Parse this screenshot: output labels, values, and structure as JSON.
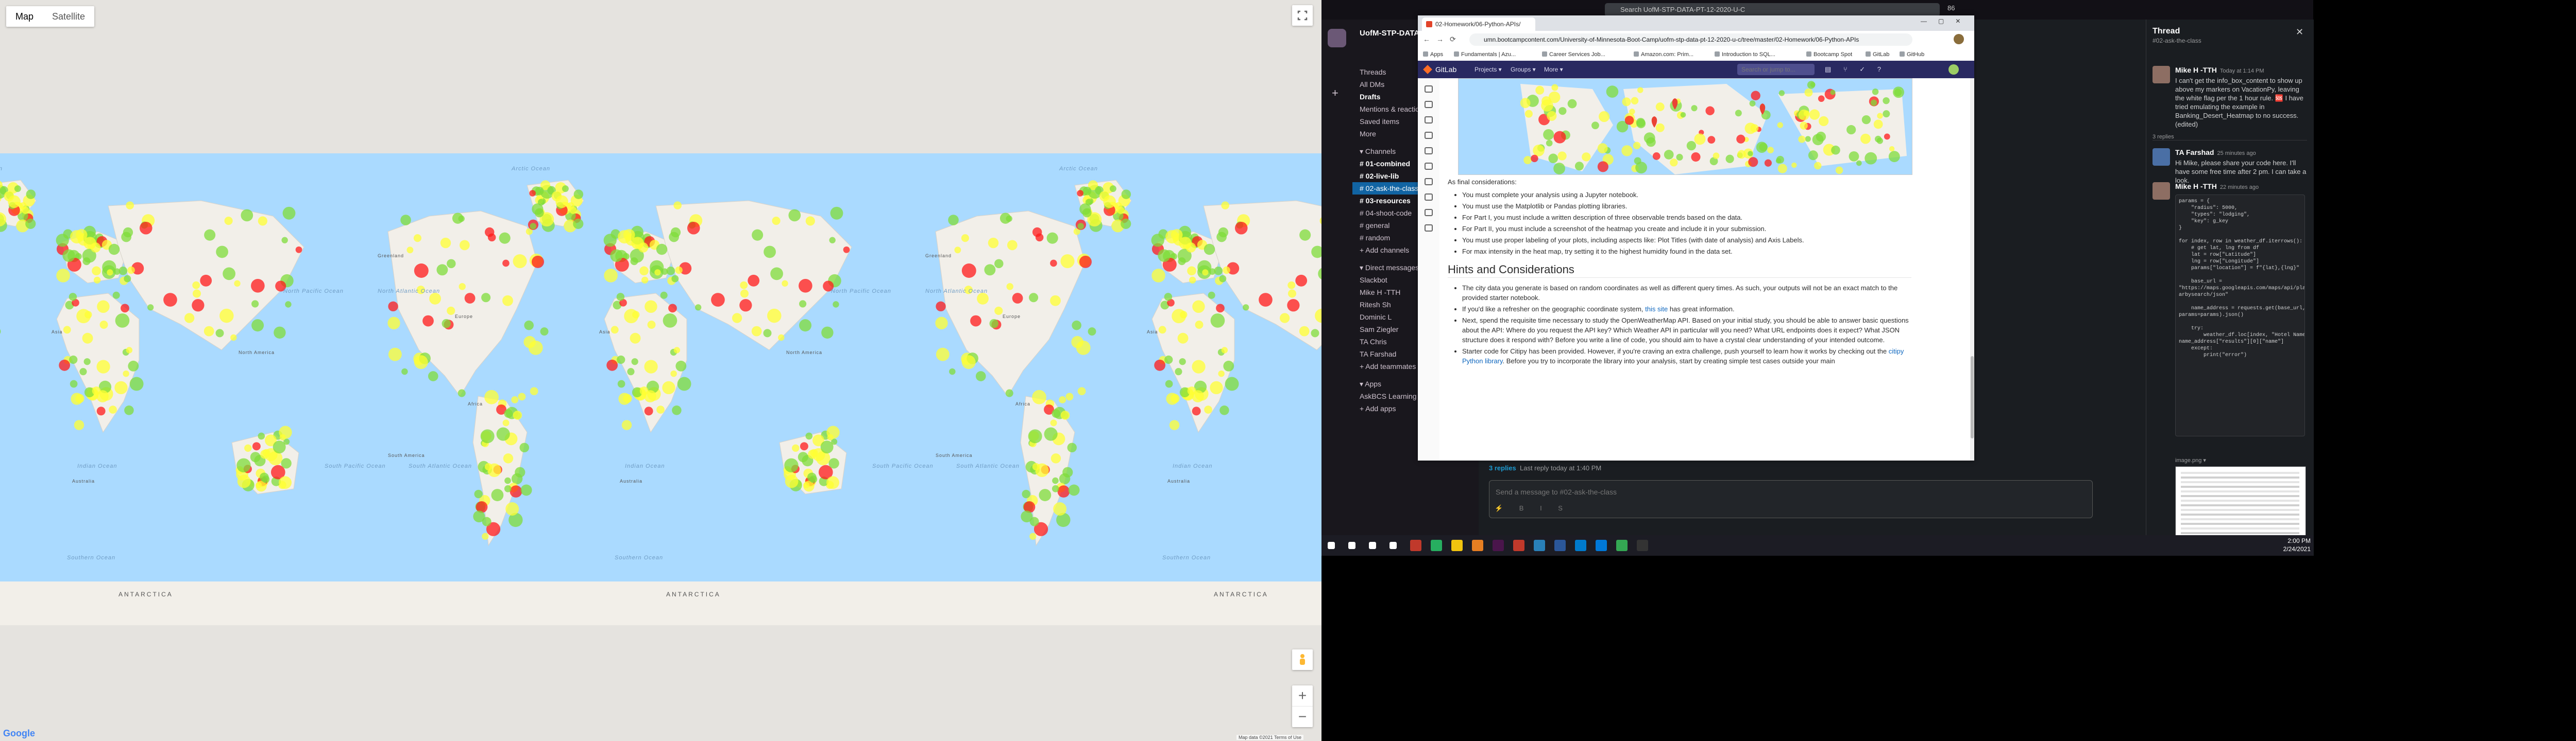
{
  "map": {
    "type_control": {
      "map_label": "Map",
      "satellite_label": "Satellite"
    },
    "google_logo": "Google",
    "attribution": "Map data ©2021   Terms of Use",
    "ocean_labels": {
      "arctic": "Arctic Ocean",
      "north_pacific": "North Pacific Ocean",
      "south_pacific": "South Pacific Ocean",
      "north_atlantic": "North Atlantic Ocean",
      "south_atlantic": "South Atlantic Ocean",
      "indian": "Indian Ocean",
      "southern": "Southern Ocean"
    },
    "continent_labels": {
      "north_america": "North America",
      "south_america": "South America",
      "africa": "Africa",
      "europe": "Europe",
      "asia": "Asia",
      "australia": "Australia",
      "greenland": "Greenland",
      "antarctica": "ANTARCTICA"
    },
    "zoom_in": "+",
    "zoom_out": "−",
    "heatmap_colors": {
      "low": "#7fdc3a",
      "mid": "#ffff33",
      "high": "#ff1a1a"
    }
  },
  "slack": {
    "search_placeholder": "Search UofM-STP-DATA-PT-12-2020-U-C",
    "workspace": "UofM-STP-DATA-PT",
    "nav": [
      "Threads",
      "All DMs",
      "Drafts",
      "Mentions & reactions",
      "Saved items",
      "More"
    ],
    "channels_header": "Channels",
    "channels": [
      "01-combined",
      "02-live-lib",
      "02-ask-the-class",
      "03-resources",
      "04-shoot-code",
      "general",
      "random"
    ],
    "add_channels": "Add channels",
    "dm_header": "Direct messages",
    "dms": [
      "Slackbot",
      "Mike H -TTH",
      "Ritesh Sh",
      "Dominic L",
      "Sam Ziegler",
      "TA Chris",
      "TA Farshad"
    ],
    "add_teammates": "Add teammates",
    "apps_header": "Apps",
    "apps": [
      "AskBCS Learning Assistant"
    ],
    "add_apps": "Add apps",
    "reply_count": "3 replies",
    "reply_last": "Last reply today at 1:40 PM",
    "composer_placeholder": "Send a message to #02-ask-the-class",
    "header_count": "86",
    "thread": {
      "title": "Thread",
      "subtitle": "#02-ask-the-class",
      "close": "✕",
      "messages": [
        {
          "name": "Mike H -TTH",
          "time": "Today at 1:14 PM",
          "text": "I can't get the info_box_content to show up above my markers on VacationPy, leaving the white flag per the 1 hour rule. 🆘 I have tried emulating the example in Banking_Desert_Heatmap to no success. (edited)"
        },
        {
          "name": "TA Farshad",
          "time": "25 minutes ago",
          "text": "Hi Mike, please share your code here. I'll have some free time after 2 pm. I can take a look."
        },
        {
          "name": "Mike H -TTH",
          "time": "22 minutes ago",
          "text": ""
        }
      ],
      "replies_label": "3 replies",
      "code": "params = {\n    \"radius\": 5000,\n    \"types\": \"lodging\",\n    \"key\": g_key\n}\n\nfor index, row in weather_df.iterrows():\n    # get lat, lng from df\n    lat = row[\"Latitude\"]\n    lng = row[\"Longitude\"]\n    params[\"location\"] = f\"{lat},{lng}\"\n\n    base_url =\n\"https://maps.googleapis.com/maps/api/place/ne\narbysearch/json\"\n\n    name_address = requests.get(base_url,\nparams=params).json()\n\n    try:\n        weather_df.loc[index, \"Hotel Name\"] =\nname_address[\"results\"][0][\"name\"]\n    except:\n        print(\"error\")",
      "image_label": "image.png ▾"
    }
  },
  "chrome": {
    "tab_title": "02-Homework/06-Python-APIs/",
    "url": "umn.bootcampcontent.com/University-of-Minnesota-Boot-Camp/uofm-stp-data-pt-12-2020-u-c/tree/master/02-Homework/06-Python-APIs",
    "bookmarks": [
      "Apps",
      "Fundamentals | Azu...",
      "Career Services Job...",
      "Amazon.com: Prim...",
      "Introduction to SQL...",
      "Bootcamp Spot",
      "GitLab",
      "GitHub"
    ],
    "gitlab": {
      "name": "GitLab",
      "menus": [
        "Projects ▾",
        "Groups ▾",
        "More ▾"
      ],
      "search_placeholder": "Search or jump to..."
    },
    "doc": {
      "considerations_label": "As final considerations:",
      "considerations": [
        "You must complete your analysis using a Jupyter notebook.",
        "You must use the Matplotlib or Pandas plotting libraries.",
        "For Part I, you must include a written description of three observable trends based on the data.",
        "For Part II, you must include a screenshot of the heatmap you create and include it in your submission.",
        "You must use proper labeling of your plots, including aspects like: Plot Titles (with date of analysis) and Axis Labels.",
        "For max intensity in the heat map, try setting it to the highest humidity found in the data set."
      ],
      "hints_heading": "Hints and Considerations",
      "hints_1": "The city data you generate is based on random coordinates as well as different query times. As such, your outputs will not be an exact match to the provided starter notebook.",
      "hints_2_pre": "If you'd like a refresher on the geographic coordinate system, ",
      "hints_2_link": "this site",
      "hints_2_post": " has great information.",
      "hints_3": "Next, spend the requisite time necessary to study the OpenWeatherMap API. Based on your initial study, you should be able to answer basic questions about the API: Where do you request the API key? Which Weather API in particular will you need? What URL endpoints does it expect? What JSON structure does it respond with? Before you write a line of code, you should aim to have a crystal clear understanding of your intended outcome.",
      "hints_4_pre": "Starter code for Citipy has been provided. However, if you're craving an extra challenge, push yourself to learn how it works by checking out the ",
      "hints_4_link": "citipy Python library",
      "hints_4_post": ". Before you try to incorporate the library into your analysis, start by creating simple test cases outside your main"
    }
  },
  "taskbar": {
    "time": "2:00 PM",
    "date": "2/24/2021"
  }
}
